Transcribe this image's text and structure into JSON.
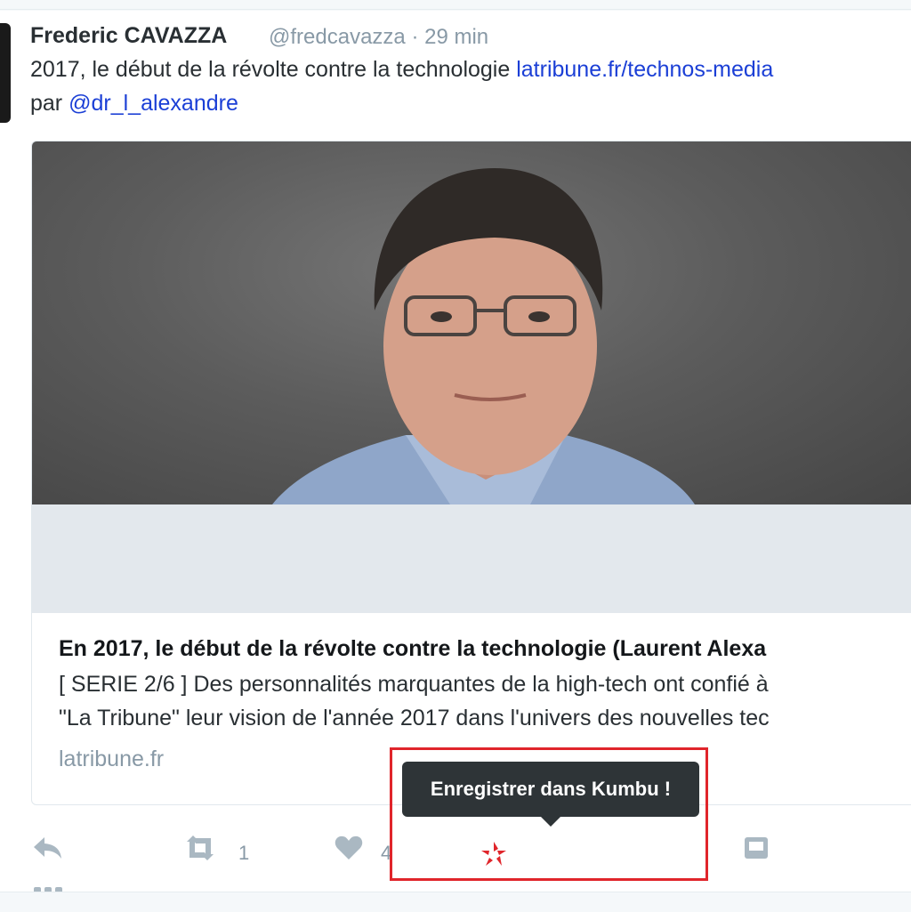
{
  "tweet": {
    "author_name": "Frederic CAVAZZA",
    "author_handle": "@fredcavazza",
    "time": "· 29 min",
    "text_line1_prefix": "2017, le début de la révolte contre la technologie ",
    "text_link": "latribune.fr/technos-media",
    "text_line2_prefix": "par ",
    "mention": "@dr_l_alexandre"
  },
  "card": {
    "title": "En 2017, le début de la révolte contre la technologie (Laurent Alexa",
    "description_line1": "[ SERIE 2/6 ] Des personnalités marquantes de la high-tech ont confié à",
    "description_line2": "\"La Tribune\" leur vision de l'année 2017 dans l'univers des nouvelles tec",
    "domain": "latribune.fr"
  },
  "actions": {
    "retweet_count": "1",
    "like_count": "4"
  },
  "tooltip": {
    "label": "Enregistrer dans Kumbu !"
  },
  "colors": {
    "highlight": "#e0252b",
    "kumbu_icon": "#e0252b",
    "link": "#1b3fd6"
  },
  "icons": [
    "reply-icon",
    "retweet-icon",
    "like-icon",
    "kumbu-icon",
    "dm-icon",
    "more-icon"
  ]
}
